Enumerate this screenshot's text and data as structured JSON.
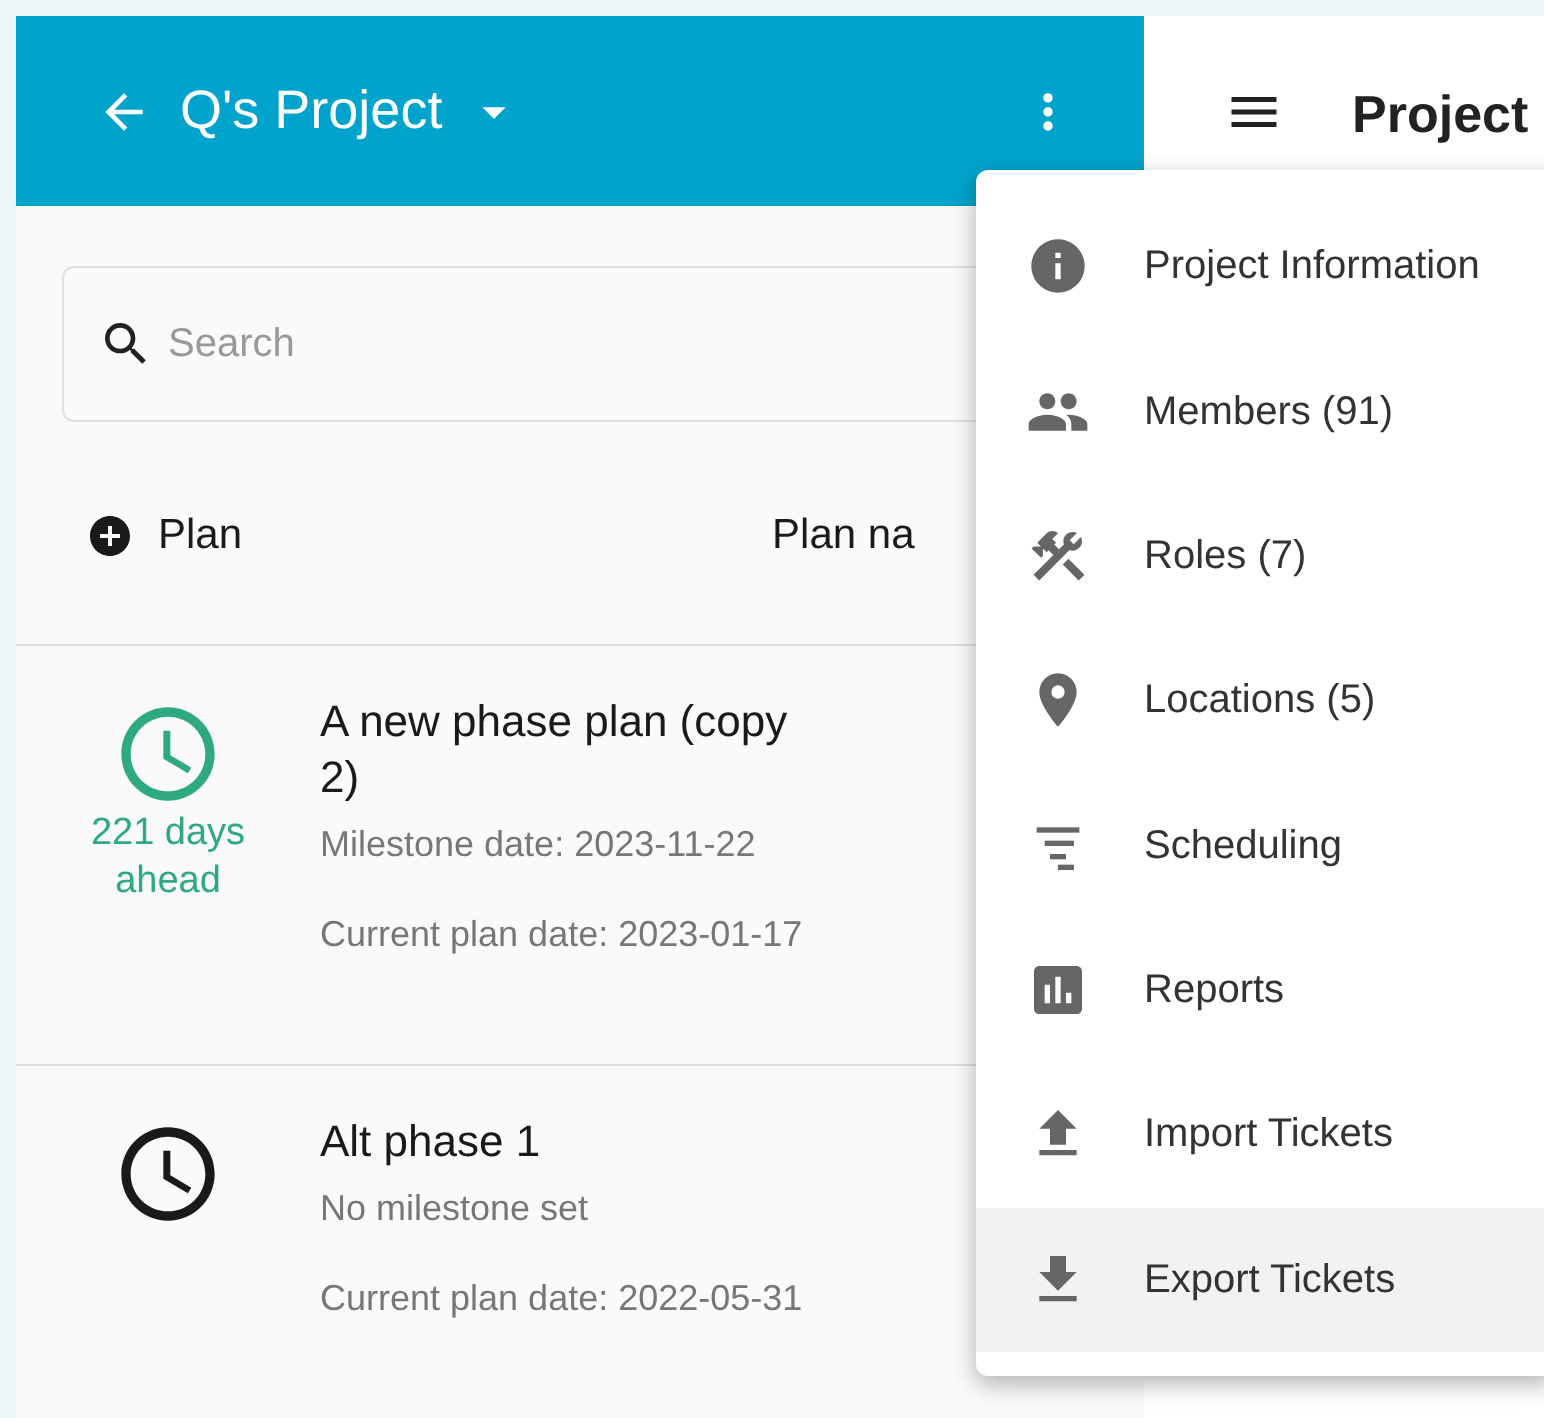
{
  "app_bar": {
    "title": "Q's Project"
  },
  "right_panel": {
    "title": "Project"
  },
  "search": {
    "placeholder": "Search"
  },
  "list_header": {
    "add_label": "Plan",
    "sort_label": "Plan na"
  },
  "plans": [
    {
      "name": "A new phase plan (copy 2)",
      "color": "#2eaa7e",
      "status": "221 days ahead",
      "milestone": "Milestone date: 2023-11-22",
      "current": "Current plan date: 2023-01-17"
    },
    {
      "name": "Alt phase 1",
      "color": "#1a1a1a",
      "milestone": "No milestone set",
      "current": "Current plan date: 2022-05-31"
    }
  ],
  "menu": [
    {
      "kind": "info",
      "label": "Project Information",
      "selected": false
    },
    {
      "kind": "members",
      "label": "Members (91)",
      "selected": false
    },
    {
      "kind": "roles",
      "label": "Roles (7)",
      "selected": false
    },
    {
      "kind": "locations",
      "label": "Locations (5)",
      "selected": false
    },
    {
      "kind": "scheduling",
      "label": "Scheduling",
      "selected": false
    },
    {
      "kind": "reports",
      "label": "Reports",
      "selected": false
    },
    {
      "kind": "import",
      "label": "Import Tickets",
      "selected": false
    },
    {
      "kind": "export",
      "label": "Export Tickets",
      "selected": true
    }
  ]
}
